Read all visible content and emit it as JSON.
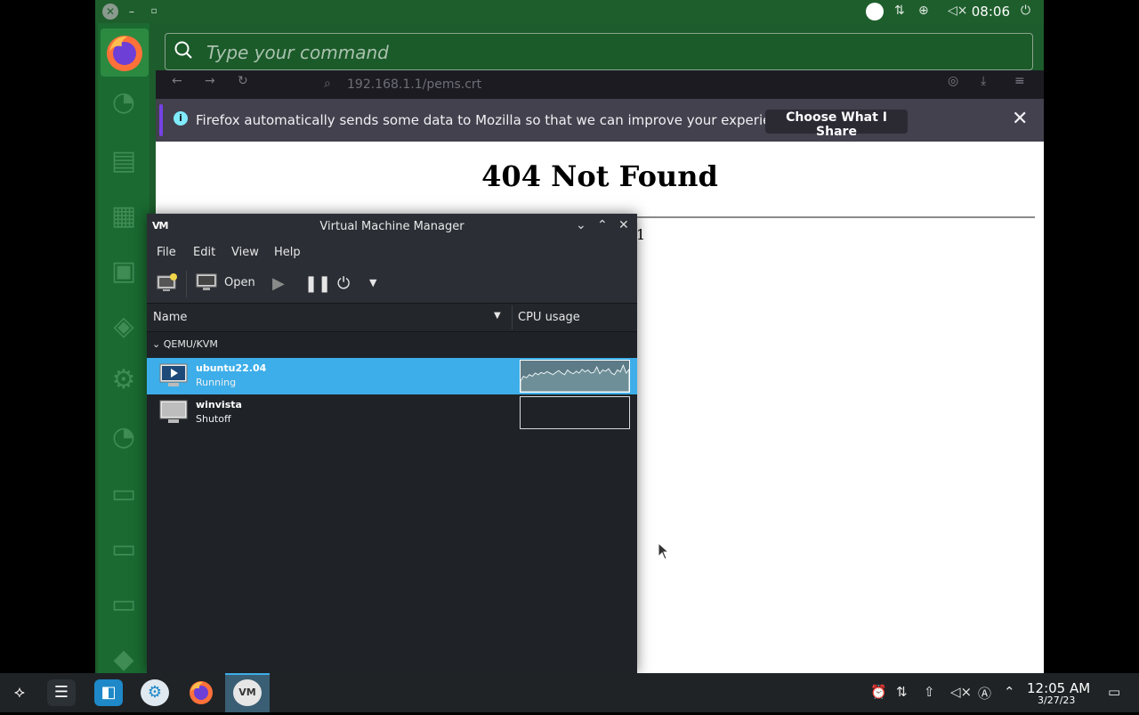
{
  "guest": {
    "clock": "08:06",
    "command_placeholder": "Type your command"
  },
  "browser": {
    "url": "192.168.1.1/pems.crt",
    "notice_text": "Firefox automatically sends some data to Mozilla so that we can improve your experience.",
    "notice_button": "Choose What I Share",
    "page_heading": "404 Not Found",
    "page_fragment": "1"
  },
  "vmm": {
    "title": "Virtual Machine Manager",
    "logo": "VM",
    "menu": [
      "File",
      "Edit",
      "View",
      "Help"
    ],
    "toolbar_open": "Open",
    "columns": {
      "name": "Name",
      "cpu": "CPU usage"
    },
    "group": "QEMU/KVM",
    "vms": [
      {
        "name": "ubuntu22.04",
        "state": "Running",
        "cpu_history": [
          0.35,
          0.5,
          0.45,
          0.55,
          0.5,
          0.6,
          0.55,
          0.62,
          0.58,
          0.65,
          0.6,
          0.55,
          0.62,
          0.68,
          0.6,
          0.55,
          0.7,
          0.62,
          0.58,
          0.66,
          0.6,
          0.72,
          0.64,
          0.7,
          0.6,
          0.62,
          0.8,
          0.58,
          0.7,
          0.66,
          0.74,
          0.6,
          0.55,
          0.7,
          0.64,
          0.85,
          0.6,
          0.72
        ]
      },
      {
        "name": "winvista",
        "state": "Shutoff",
        "cpu_history": []
      }
    ],
    "accent": "#3daee9"
  },
  "host": {
    "clock_time": "12:05 AM",
    "clock_date": "3/27/23"
  }
}
